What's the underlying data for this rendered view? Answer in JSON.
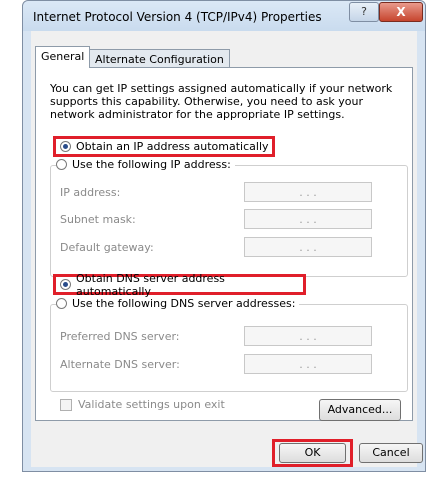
{
  "window": {
    "title": "Internet Protocol Version 4 (TCP/IPv4) Properties",
    "help_label": "?",
    "close_label": "X"
  },
  "tabs": [
    {
      "label": "General"
    },
    {
      "label": "Alternate Configuration"
    }
  ],
  "description": "You can get IP settings assigned automatically if your network supports this capability. Otherwise, you need to ask your network administrator for the appropriate IP settings.",
  "ip": {
    "auto_label": "Obtain an IP address automatically",
    "manual_label": "Use the following IP address:",
    "fields": [
      {
        "label": "IP address:",
        "value": ".    .    ."
      },
      {
        "label": "Subnet mask:",
        "value": ".    .    ."
      },
      {
        "label": "Default gateway:",
        "value": ".    .    ."
      }
    ]
  },
  "dns": {
    "auto_label": "Obtain DNS server address automatically",
    "manual_label": "Use the following DNS server addresses:",
    "fields": [
      {
        "label": "Preferred DNS server:",
        "value": ".    .    ."
      },
      {
        "label": "Alternate DNS server:",
        "value": ".    .    ."
      }
    ]
  },
  "validate_label": "Validate settings upon exit",
  "buttons": {
    "advanced": "Advanced...",
    "ok": "OK",
    "cancel": "Cancel"
  },
  "colors": {
    "highlight": "#e01f2a",
    "titlebar": "#c9dbee",
    "close": "#c6452e"
  }
}
